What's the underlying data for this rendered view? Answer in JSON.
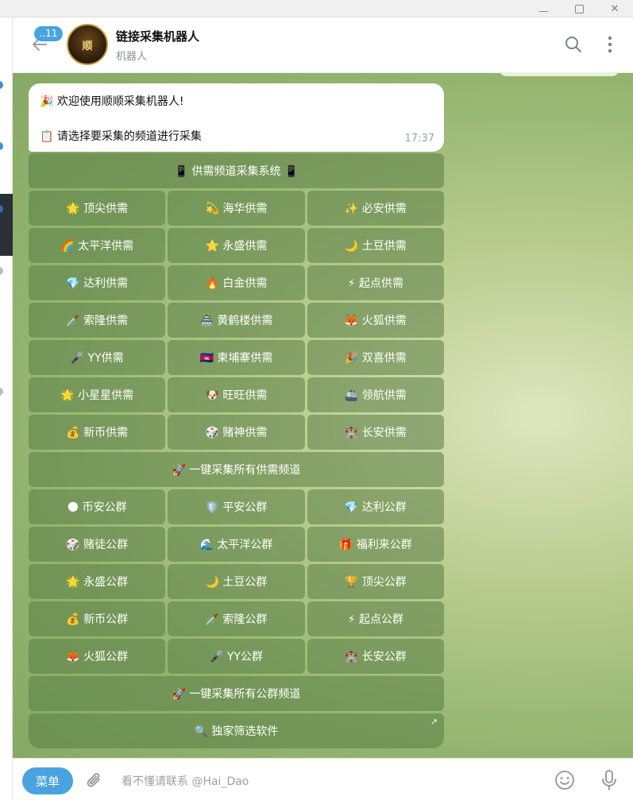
{
  "window": {
    "minimize_icon": "minimize-icon",
    "maximize_icon": "maximize-icon",
    "close_icon": "close-icon"
  },
  "header": {
    "unread_count": "..11",
    "avatar_text": "顺",
    "title": "链接采集机器人",
    "status": "机器人"
  },
  "message": {
    "line1": "🎉 欢迎使用顺顺采集机器人!",
    "line2": "📋 请选择要采集的频道进行采集",
    "time": "17:37"
  },
  "keyboard": {
    "rows": [
      [
        {
          "label": "📱 供需频道采集系统 📱"
        }
      ],
      [
        {
          "label": "🌟 顶尖供需"
        },
        {
          "label": "💫 海华供需"
        },
        {
          "label": "✨ 必安供需"
        }
      ],
      [
        {
          "label": "🌈 太平洋供需"
        },
        {
          "label": "⭐ 永盛供需"
        },
        {
          "label": "🌙 土豆供需"
        }
      ],
      [
        {
          "label": "💎 达利供需"
        },
        {
          "label": "🔥 白金供需"
        },
        {
          "label": "⚡ 起点供需"
        }
      ],
      [
        {
          "label": "🗡️ 索隆供需"
        },
        {
          "label": "🏯 黄鹤楼供需"
        },
        {
          "label": "🦊 火狐供需"
        }
      ],
      [
        {
          "label": "🎤 YY供需"
        },
        {
          "label": "🇰🇭 柬埔寨供需"
        },
        {
          "label": "🎉 双喜供需"
        }
      ],
      [
        {
          "label": "🌟 小星星供需"
        },
        {
          "label": "🐶 旺旺供需"
        },
        {
          "label": "🚢 领航供需"
        }
      ],
      [
        {
          "label": "💰 新币供需"
        },
        {
          "label": "🎲 赌神供需"
        },
        {
          "label": "🏰 长安供需"
        }
      ],
      [
        {
          "label": "🚀 一键采集所有供需频道"
        }
      ],
      [
        {
          "label": "🌑 币安公群"
        },
        {
          "label": "🛡️ 平安公群"
        },
        {
          "label": "💎 达利公群"
        }
      ],
      [
        {
          "label": "🎲 赌徒公群"
        },
        {
          "label": "🌊 太平洋公群"
        },
        {
          "label": "🎁 福利来公群"
        }
      ],
      [
        {
          "label": "🌟 永盛公群"
        },
        {
          "label": "🌙 土豆公群"
        },
        {
          "label": "🏆 顶尖公群"
        }
      ],
      [
        {
          "label": "💰 新币公群"
        },
        {
          "label": "🗡️ 索隆公群"
        },
        {
          "label": "⚡ 起点公群"
        }
      ],
      [
        {
          "label": "🦊 火狐公群"
        },
        {
          "label": "🎤 YY公群"
        },
        {
          "label": "🏰 长安公群"
        }
      ],
      [
        {
          "label": "🚀 一键采集所有公群频道"
        }
      ],
      [
        {
          "label": "🔍 独家筛选软件",
          "external": "↗"
        }
      ]
    ]
  },
  "composer": {
    "menu_label": "菜单",
    "placeholder": "看不懂请联系 @Hai_Dao"
  },
  "colors": {
    "accent": "#4aa3df",
    "keyboard_button": "#5a7d46",
    "chat_bg": "#b9cc8f"
  }
}
